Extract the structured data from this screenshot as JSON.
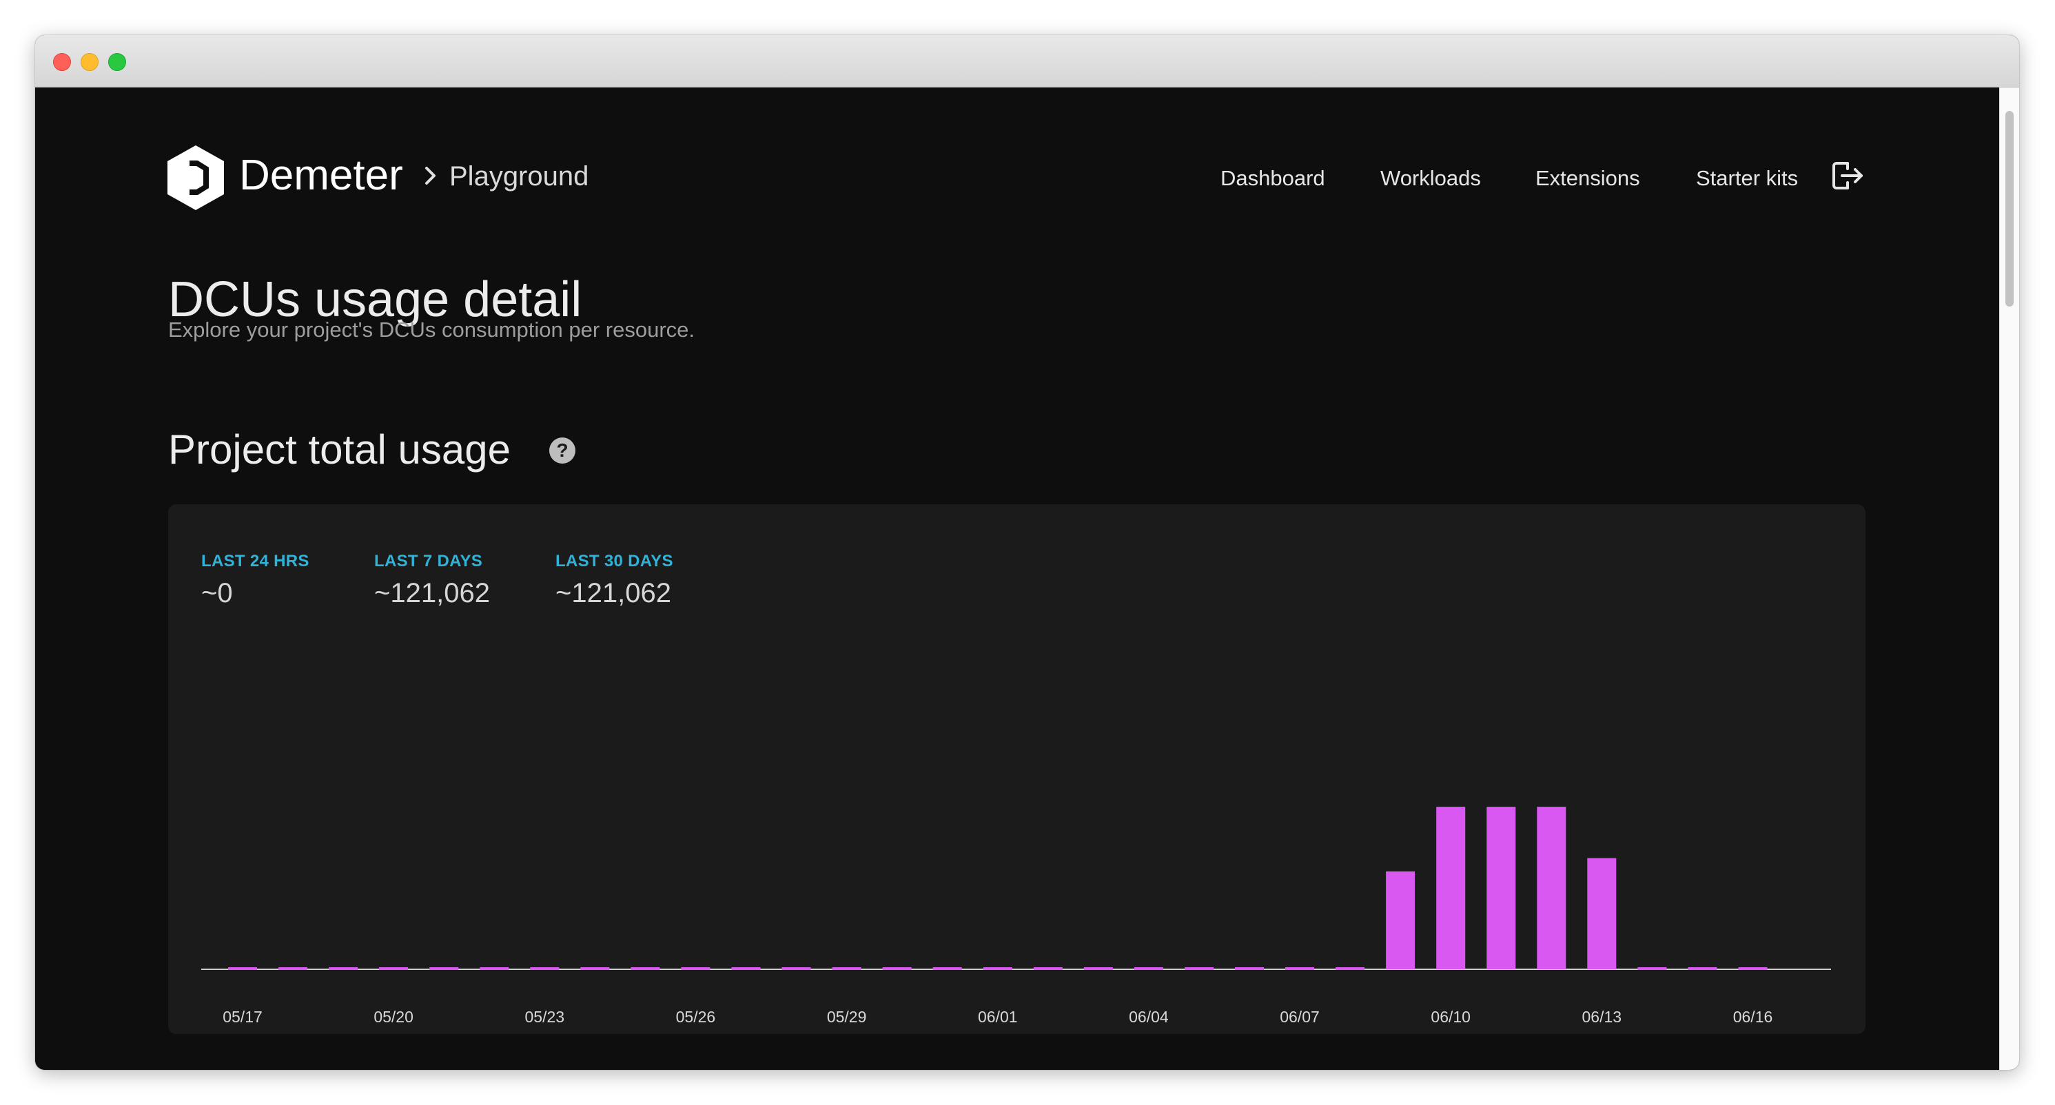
{
  "app": {
    "brand": "Demeter",
    "project": "Playground"
  },
  "nav": {
    "items": [
      "Dashboard",
      "Workloads",
      "Extensions",
      "Starter kits"
    ],
    "logout_icon": "logout-icon"
  },
  "page": {
    "title": "DCUs usage detail",
    "subtitle": "Explore your project's DCUs consumption per resource."
  },
  "section": {
    "title": "Project total usage",
    "help_icon": "question-icon",
    "help_glyph": "?"
  },
  "stats": [
    {
      "label": "LAST 24 HRS",
      "value": "~0"
    },
    {
      "label": "LAST 7 DAYS",
      "value": "~121,062"
    },
    {
      "label": "LAST 30 DAYS",
      "value": "~121,062"
    }
  ],
  "colors": {
    "bar": "#d958f2",
    "accent": "#2fb3d9",
    "card": "#1b1b1b",
    "background": "#0e0e0e"
  },
  "chart_data": {
    "type": "bar",
    "categories": [
      "05/17",
      "05/18",
      "05/19",
      "05/20",
      "05/21",
      "05/22",
      "05/23",
      "05/24",
      "05/25",
      "05/26",
      "05/27",
      "05/28",
      "05/29",
      "05/30",
      "05/31",
      "06/01",
      "06/02",
      "06/03",
      "06/04",
      "06/05",
      "06/06",
      "06/07",
      "06/08",
      "06/09",
      "06/10",
      "06/11",
      "06/12",
      "06/13",
      "06/14",
      "06/15",
      "06/16"
    ],
    "tick_labels": [
      "05/17",
      "05/20",
      "05/23",
      "05/26",
      "05/29",
      "06/01",
      "06/04",
      "06/07",
      "06/10",
      "06/13",
      "06/16"
    ],
    "values": [
      0,
      0,
      0,
      0,
      0,
      0,
      0,
      0,
      0,
      0,
      0,
      0,
      0,
      0,
      0,
      0,
      0,
      0,
      0,
      0,
      0,
      0,
      0,
      14700,
      24400,
      24400,
      24400,
      16700,
      0,
      0,
      0
    ],
    "ylim": [
      0,
      30000
    ],
    "grid": false,
    "legend": "none"
  }
}
